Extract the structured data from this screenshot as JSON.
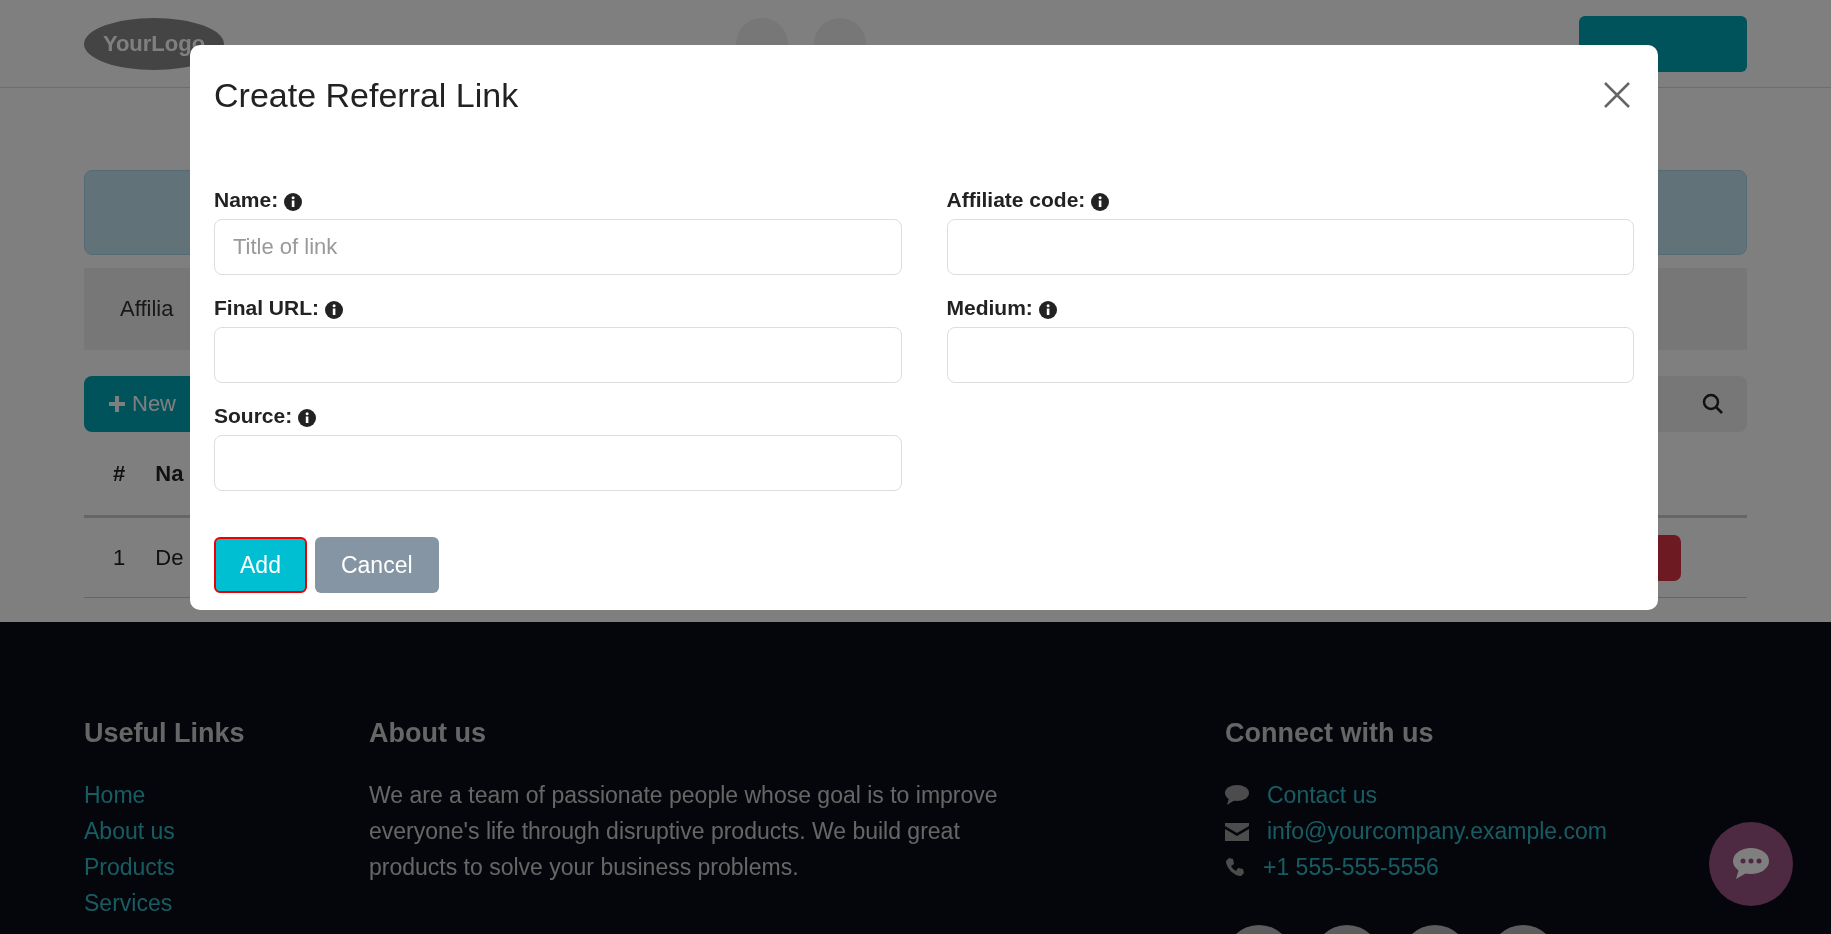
{
  "header": {
    "logo": "YourLogo"
  },
  "page": {
    "bar_text": "Affilia",
    "new_button": "New",
    "table": {
      "columns": [
        "#",
        "Na"
      ],
      "rows": [
        [
          "1",
          "De"
        ]
      ]
    }
  },
  "dialog": {
    "title": "Create Referral Link",
    "left_fields": [
      {
        "label": "Name:",
        "placeholder": "Title of link"
      },
      {
        "label": "Final URL:"
      },
      {
        "label": "Source:"
      }
    ],
    "right_fields": [
      {
        "label": "Affiliate code:"
      },
      {
        "label": "Medium:"
      }
    ],
    "buttons": [
      {
        "label": "Add",
        "kind": "primary",
        "focused": true
      },
      {
        "label": "Cancel",
        "kind": "secondary",
        "focused": false
      }
    ]
  },
  "footer": {
    "links_title": "Useful Links",
    "links": [
      "Home",
      "About us",
      "Products",
      "Services"
    ],
    "about_title": "About us",
    "about_text": "We are a team of passionate people whose goal is to improve everyone's life through disruptive products. We build great products to solve your business problems.",
    "connect_title": "Connect with us",
    "contacts": [
      {
        "kind": "chat",
        "label": "Contact us"
      },
      {
        "kind": "mail",
        "label": "info@yourcompany.example.com"
      },
      {
        "kind": "phone",
        "label": "+1 555-555-5556"
      }
    ]
  }
}
